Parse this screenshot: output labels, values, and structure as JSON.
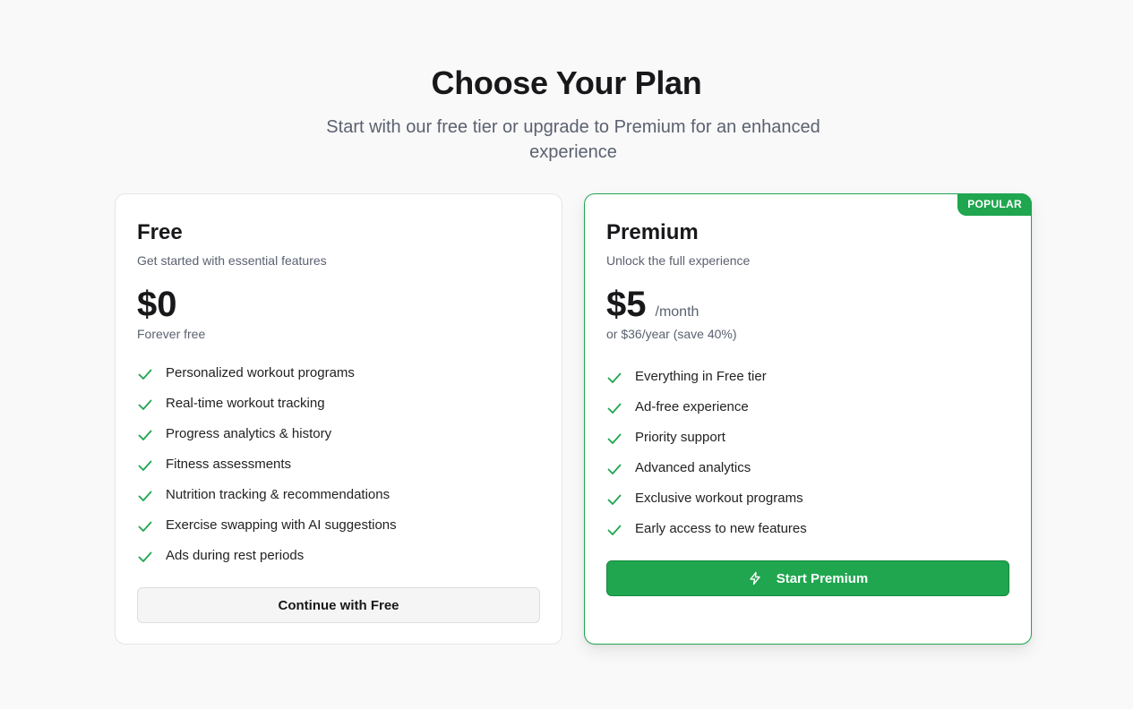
{
  "header": {
    "title": "Choose Your Plan",
    "subtitle": "Start with our free tier or upgrade to Premium for an enhanced experience"
  },
  "plans": {
    "free": {
      "name": "Free",
      "description": "Get started with essential features",
      "price": "$0",
      "price_note": "Forever free",
      "features": [
        "Personalized workout programs",
        "Real-time workout tracking",
        "Progress analytics & history",
        "Fitness assessments",
        "Nutrition tracking & recommendations",
        "Exercise swapping with AI suggestions",
        "Ads during rest periods"
      ],
      "button_label": "Continue with Free"
    },
    "premium": {
      "badge": "POPULAR",
      "name": "Premium",
      "description": "Unlock the full experience",
      "price": "$5",
      "period": "/month",
      "price_note": "or $36/year (save 40%)",
      "features": [
        "Everything in Free tier",
        "Ad-free experience",
        "Priority support",
        "Advanced analytics",
        "Exclusive workout programs",
        "Early access to new features"
      ],
      "button_label": "Start Premium",
      "button_icon": "bolt-icon"
    }
  },
  "colors": {
    "accent": "#1fa64f",
    "check": "#1fa64f",
    "background": "#f9f9f9"
  },
  "icons": {
    "feature_check": "check-icon"
  }
}
